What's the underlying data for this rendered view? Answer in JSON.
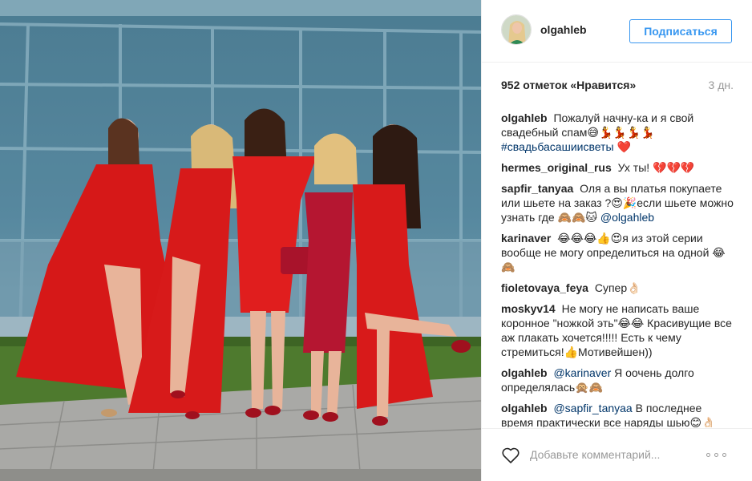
{
  "post": {
    "author": "olgahleb",
    "follow_label": "Подписаться",
    "likes": "952 отметок «Нравится»",
    "time_ago": "3 дн.",
    "add_comment_placeholder": "Добавьте комментарий...",
    "more_options_icon": "more-options-icon",
    "like_icon": "heart-outline-icon"
  },
  "comments": [
    {
      "user": "olgahleb",
      "text": "Пожалуй начну-ка и я свой свадебный спам😅💃💃💃💃",
      "hashtag": "#свадьбасашиисветы",
      "emoji_after": "❤️"
    },
    {
      "user": "hermes_original_rus",
      "text": "Ух ты! 💔💔💔"
    },
    {
      "user": "sapfir_tanyaa",
      "text": "Оля а вы платья покупаете или шьете на заказ ?😍🎉если шьете можно узнать где 🙈🙈🐱",
      "mention": "@olgahleb"
    },
    {
      "user": "karinaver",
      "text": "😂😂😂👍😍я из этой серии вообще не могу определиться на одной 😂🙈"
    },
    {
      "user": "fioletovaya_feya",
      "text": "Супер👌🏻"
    },
    {
      "user": "moskyv14",
      "text": "Не могу не написать ваше коронное \"ножкой эть\"😂😂 Красивущие все аж плакать хочется!!!!! Есть к чему стремиться!👍Мотивейшен))"
    },
    {
      "user": "olgahleb",
      "mention": "@karinaver",
      "text": "Я оочень долго определялась🙊🙈"
    },
    {
      "user": "olgahleb",
      "mention": "@sapfir_tanyaa",
      "text": "В последнее время практически все наряды шью😊👌🏻"
    }
  ],
  "colors": {
    "accent": "#3897f0",
    "hashtag": "#003569",
    "dress_red": "#d81a1a",
    "building_blue": "#5d8ea5"
  }
}
